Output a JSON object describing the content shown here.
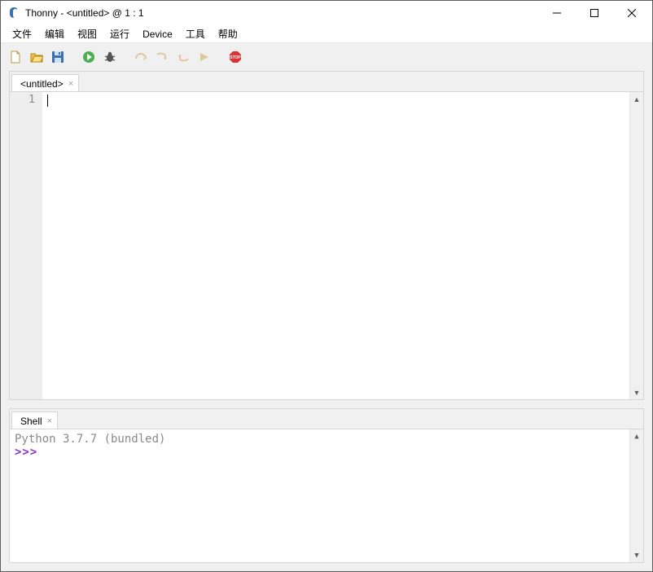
{
  "window": {
    "title": "Thonny  -  <untitled>  @  1 : 1"
  },
  "menu": {
    "file": "文件",
    "edit": "编辑",
    "view": "视图",
    "run": "运行",
    "device": "Device",
    "tools": "工具",
    "help": "帮助"
  },
  "toolbar_icons": {
    "new": "new-file-icon",
    "open": "open-file-icon",
    "save": "save-file-icon",
    "run": "run-icon",
    "debug": "debug-icon",
    "step_over": "step-over-icon",
    "step_into": "step-into-icon",
    "step_out": "step-out-icon",
    "resume": "resume-icon",
    "stop": "stop-icon"
  },
  "editor": {
    "tab_label": "<untitled>",
    "line_number": "1",
    "content": ""
  },
  "shell": {
    "tab_label": "Shell",
    "banner": "Python 3.7.7 (bundled)",
    "prompt": ">>>"
  }
}
